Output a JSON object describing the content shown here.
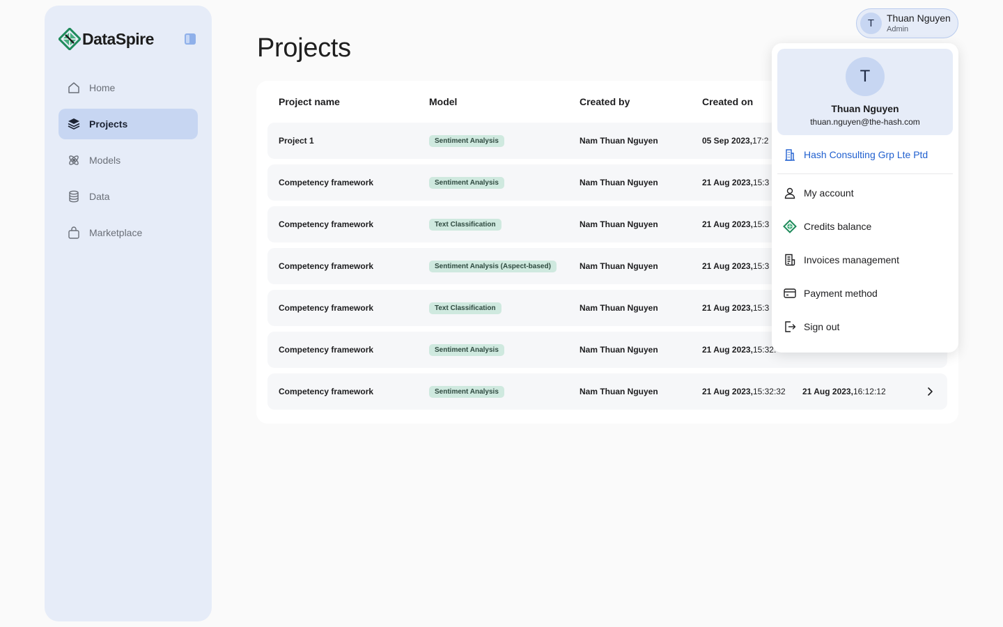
{
  "app": {
    "brand": "DataSpire",
    "brand_color": "#1e8a5a"
  },
  "sidebar": {
    "items": [
      {
        "label": "Home",
        "icon": "home-icon",
        "active": false
      },
      {
        "label": "Projects",
        "icon": "layers-icon",
        "active": true
      },
      {
        "label": "Models",
        "icon": "atom-icon",
        "active": false
      },
      {
        "label": "Data",
        "icon": "database-icon",
        "active": false
      },
      {
        "label": "Marketplace",
        "icon": "shopping-bag-icon",
        "active": false
      }
    ]
  },
  "page": {
    "title": "Projects"
  },
  "table": {
    "columns": [
      "Project name",
      "Model",
      "Created by",
      "Created on"
    ],
    "rows": [
      {
        "name": "Project 1",
        "model": "Sentiment Analysis",
        "created_by": "Nam Thuan Nguyen",
        "created_date": "05 Sep 2023,",
        "created_time": " 17:2",
        "updated_date": "",
        "updated_time": ""
      },
      {
        "name": "Competency framework",
        "model": "Sentiment Analysis",
        "created_by": "Nam Thuan Nguyen",
        "created_date": "21 Aug 2023,",
        "created_time": " 15:3",
        "updated_date": "",
        "updated_time": ""
      },
      {
        "name": "Competency framework",
        "model": "Text Classification",
        "created_by": "Nam Thuan Nguyen",
        "created_date": "21 Aug 2023,",
        "created_time": " 15:3",
        "updated_date": "",
        "updated_time": ""
      },
      {
        "name": "Competency framework",
        "model": "Sentiment Analysis (Aspect-based)",
        "created_by": "Nam Thuan Nguyen",
        "created_date": "21 Aug 2023,",
        "created_time": " 15:3",
        "updated_date": "",
        "updated_time": ""
      },
      {
        "name": "Competency framework",
        "model": "Text Classification",
        "created_by": "Nam Thuan Nguyen",
        "created_date": "21 Aug 2023,",
        "created_time": " 15:3",
        "updated_date": "",
        "updated_time": ""
      },
      {
        "name": "Competency framework",
        "model": "Sentiment Analysis",
        "created_by": "Nam Thuan Nguyen",
        "created_date": "21 Aug 2023,",
        "created_time": " 15:32:",
        "updated_date": "",
        "updated_time": ""
      },
      {
        "name": "Competency framework",
        "model": "Sentiment Analysis",
        "created_by": "Nam Thuan Nguyen",
        "created_date": "21 Aug 2023,",
        "created_time": " 15:32:32",
        "updated_date": "21 Aug 2023,",
        "updated_time": " 16:12:12"
      }
    ]
  },
  "user": {
    "initial": "T",
    "name": "Thuan Nguyen",
    "role": "Admin",
    "email": "thuan.nguyen@the-hash.com",
    "organization": "Hash Consulting Grp Lte Ptd"
  },
  "menu": {
    "items": [
      {
        "label": "My account",
        "icon": "user-icon"
      },
      {
        "label": "Credits balance",
        "icon": "credits-icon"
      },
      {
        "label": "Invoices management",
        "icon": "invoice-icon"
      },
      {
        "label": "Payment method",
        "icon": "credit-card-icon"
      },
      {
        "label": "Sign out",
        "icon": "sign-out-icon"
      }
    ]
  }
}
